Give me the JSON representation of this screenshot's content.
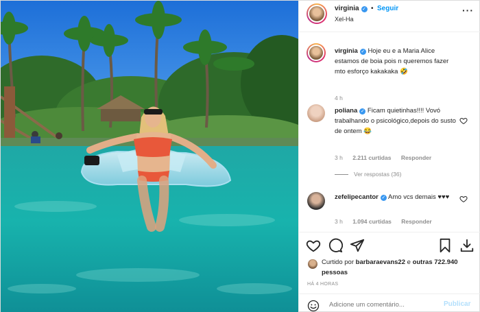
{
  "post": {
    "image_alt": "Woman in orange bikini on inflatable float in turquoise lagoon with palm trees"
  },
  "header": {
    "username": "virginia",
    "separator": "•",
    "follow_label": "Seguir",
    "location": "Xel-Ha",
    "more_label": "···"
  },
  "caption": {
    "username": "virginia",
    "text": "Hoje eu e a Maria Alice estamos de boia pois n queremos fazer mto esforço kakakaka 🤣",
    "time": "4 h"
  },
  "comments": [
    {
      "username": "poliana",
      "text": "Ficam quietinhas!!!! Vovó trabalhando o psicológico,depois do susto de ontem 😂",
      "time": "3 h",
      "likes": "2.211 curtidas",
      "reply_label": "Responder",
      "view_replies": "Ver respostas (36)"
    },
    {
      "username": "zefelipecantor",
      "text": "Amo vcs demais ♥♥♥",
      "time": "3 h",
      "likes": "1.094 curtidas",
      "reply_label": "Responder"
    }
  ],
  "actions": {
    "like_icon": "heart-icon",
    "comment_icon": "comment-icon",
    "share_icon": "paper-plane-icon",
    "save_icon": "bookmark-icon",
    "download_icon": "download-icon"
  },
  "likes": {
    "prefix": "Curtido por",
    "liker": "barbaraevans22",
    "middle": "e",
    "count_text": "outras 722.940 pessoas"
  },
  "timestamp": "HÁ 4 HORAS",
  "add_comment": {
    "placeholder": "Adicione um comentário...",
    "publish_label": "Publicar"
  },
  "colors": {
    "accent": "#0095f6",
    "verified": "#3897f0",
    "muted": "#8e8e8e",
    "publish_disabled": "#b2dffc"
  }
}
